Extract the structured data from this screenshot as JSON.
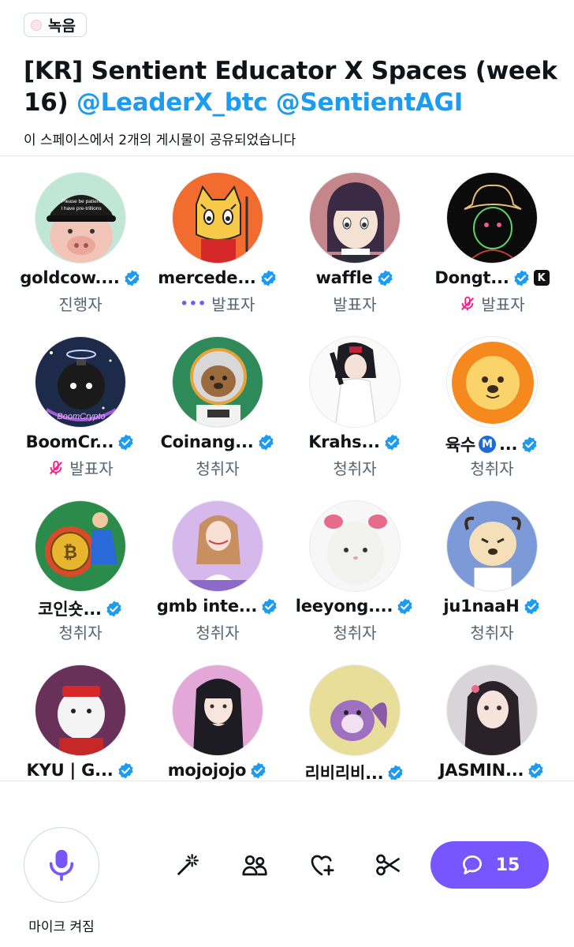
{
  "header": {
    "recording_label": "녹음",
    "title_main": "[KR] Sentient Educator X Spaces (week 16) ",
    "title_mentions": "@LeaderX_btc @SentientAGI",
    "shared_posts": "이 스페이스에서 2개의 게시물이 공유되었습니다"
  },
  "participants": [
    {
      "name": "goldcow....",
      "role": "진행자"
    },
    {
      "name": "mercede...",
      "role": "발표자",
      "status": "speaking"
    },
    {
      "name": "waffle",
      "role": "발표자"
    },
    {
      "name": "Dongt...",
      "role": "발표자",
      "status": "muted",
      "badge": "K"
    },
    {
      "name": "BoomCr...",
      "role": "발표자",
      "status": "muted"
    },
    {
      "name": "Coinang...",
      "role": "청취자"
    },
    {
      "name": "Krahs...",
      "role": "청취자"
    },
    {
      "name": "육수",
      "role": "청취자",
      "badge": "M",
      "suffix": "..."
    },
    {
      "name": "코인숏...",
      "role": "청취자"
    },
    {
      "name": "gmb inte...",
      "role": "청취자"
    },
    {
      "name": "leeyong....",
      "role": "청취자"
    },
    {
      "name": "ju1naaH",
      "role": "청취자"
    },
    {
      "name": "KYU | G...",
      "role": ""
    },
    {
      "name": "mojojojo",
      "role": ""
    },
    {
      "name": "리비리비...",
      "role": ""
    },
    {
      "name": "JASMIN...",
      "role": ""
    }
  ],
  "avatar_art": {
    "goldcow_cap_text": "Please be patient",
    "goldcow_cap_text2": "I have pre-trillions",
    "boom_text": "BoomCrypto"
  },
  "bottom_bar": {
    "mic_label": "마이크 켜짐",
    "comment_count": "15"
  },
  "colors": {
    "accent": "#7856ff",
    "link": "#1d9bf0",
    "verified": "#1d9bf0",
    "muted_icon": "#f91880"
  },
  "icons": {
    "mic": "microphone-icon",
    "effects": "magic-wand-icon",
    "people": "people-icon",
    "react": "heart-plus-icon",
    "clip": "scissors-icon",
    "comment": "speech-bubble-icon"
  }
}
